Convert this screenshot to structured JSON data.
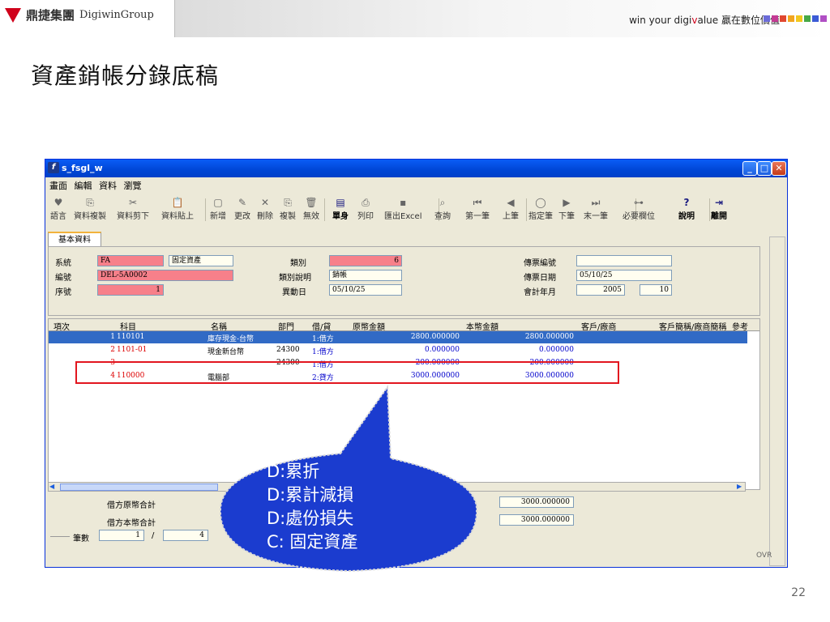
{
  "slide": {
    "brand_cn": "鼎捷集團",
    "brand_en": "DigiwinGroup",
    "slogan_pre": "win your digi",
    "slogan_v": "v",
    "slogan_post": "alue",
    "slogan_cn": "贏在數位價值",
    "title": "資產銷帳分錄底稿",
    "page_number": "22",
    "square_colors": [
      "#6b6bd8",
      "#c43a94",
      "#e0472f",
      "#f2a51f",
      "#f2c81f",
      "#47a846",
      "#3b5bd6",
      "#b04fc4"
    ]
  },
  "window": {
    "title": "s_fsgl_w",
    "icon": "f",
    "menu": [
      "畫面",
      "編輯",
      "資料",
      "瀏覽"
    ],
    "toolbar": [
      {
        "label": "語言",
        "icon": "♥",
        "name": "language"
      },
      {
        "label": "資料複製",
        "icon": "⎘",
        "name": "copy"
      },
      {
        "label": "資料剪下",
        "icon": "✂",
        "name": "cut"
      },
      {
        "label": "資料貼上",
        "icon": "📋",
        "name": "paste"
      },
      {
        "label": "新增",
        "icon": "▢",
        "name": "new"
      },
      {
        "label": "更改",
        "icon": "✎",
        "name": "edit"
      },
      {
        "label": "刪除",
        "icon": "✕",
        "name": "delete"
      },
      {
        "label": "複製",
        "icon": "⎘",
        "name": "duplicate"
      },
      {
        "label": "無效",
        "icon": "🗑",
        "name": "invalid"
      },
      {
        "label": "單身",
        "icon": "▤",
        "name": "detail"
      },
      {
        "label": "列印",
        "icon": "⎙",
        "name": "print"
      },
      {
        "label": "匯出Excel",
        "icon": "▪",
        "name": "export-excel"
      },
      {
        "label": "查詢",
        "icon": "⌕",
        "name": "query"
      },
      {
        "label": "第一筆",
        "icon": "⏮",
        "name": "first"
      },
      {
        "label": "上筆",
        "icon": "◀",
        "name": "prev"
      },
      {
        "label": "指定筆",
        "icon": "◯",
        "name": "goto"
      },
      {
        "label": "下筆",
        "icon": "▶",
        "name": "next"
      },
      {
        "label": "末一筆",
        "icon": "⏭",
        "name": "last"
      },
      {
        "label": "必要欄位",
        "icon": "⊶",
        "name": "required-fields"
      },
      {
        "label": "說明",
        "icon": "?",
        "name": "help"
      },
      {
        "label": "離開",
        "icon": "⇥",
        "name": "exit"
      }
    ],
    "tab_label": "基本資料",
    "form": {
      "system_label": "系統",
      "system_value": "FA",
      "system_name": "固定資產",
      "no_label": "編號",
      "no_value": "DEL-5A0002",
      "seq_label": "序號",
      "seq_value": "1",
      "cat_label": "類別",
      "cat_value": "6",
      "catdesc_label": "類別說明",
      "catdesc_value": "銷帳",
      "chgdate_label": "異動日",
      "chgdate_value": "05/10/25",
      "vno_label": "傳票編號",
      "vno_value": "",
      "vdate_label": "傳票日期",
      "vdate_value": "05/10/25",
      "period_label": "會計年月",
      "year_value": "2005",
      "month_value": "10"
    },
    "grid": {
      "headers": [
        "項次",
        "科目",
        "名稱",
        "部門",
        "借/貸",
        "原幣金額",
        "本幣金額",
        "客戶/廠商",
        "客戶簡稱/廠商簡稱",
        "參考"
      ],
      "rows": [
        {
          "seq": "1",
          "acct": "110101",
          "name": "庫存現金-台幣",
          "dept": "",
          "dc": "1:借方",
          "orig": "2800.000000",
          "local": "2800.000000"
        },
        {
          "seq": "2",
          "acct": "1101-01",
          "name": "現金新台幣",
          "dept": "24300",
          "dc": "1:借方",
          "orig": "0.000000",
          "local": "0.000000"
        },
        {
          "seq": "3",
          "acct": "",
          "name": "",
          "dept": "24300",
          "dc": "1:借方",
          "orig": "200.000000",
          "local": "200.000000"
        },
        {
          "seq": "4",
          "acct": "110000",
          "name": "電腦部",
          "dept": "",
          "dc": "2:貸方",
          "orig": "3000.000000",
          "local": "3000.000000"
        }
      ]
    },
    "footer": {
      "debit_orig_label": "借方原幣合計",
      "debit_local_label": "借方本幣合計",
      "credit_orig_total": "3000.000000",
      "credit_local_total": "3000.000000",
      "count_label": "筆數",
      "count_current": "1",
      "count_sep": "/",
      "count_total": "4",
      "status": "OVR"
    }
  },
  "callout": {
    "lines": [
      "D:累折",
      "D:累計減損",
      "D:處份損失",
      "C: 固定資產"
    ],
    "color": "#1b3ccf"
  }
}
